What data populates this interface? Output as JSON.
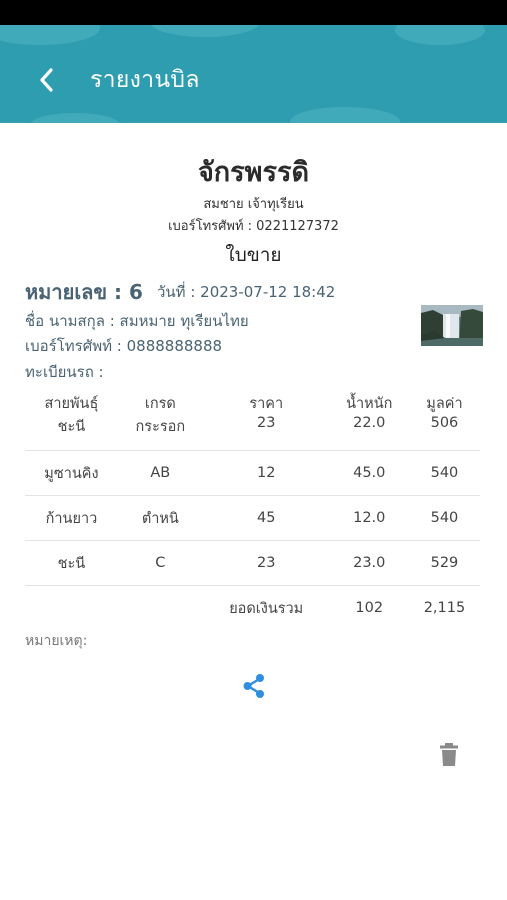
{
  "header": {
    "title": "รายงานบิล",
    "back_icon": "chevron-left-icon",
    "color": "#2f9db0"
  },
  "shop": {
    "name": "จักรพรรดิ",
    "owner": "สมชาย เจ้าทุเรียน",
    "phone": "เบอร์โทรศัพท์ : 0221127372"
  },
  "document_type": "ใบขาย",
  "bill": {
    "number": "หมายเลข : 6",
    "date": "วันที่ : 2023-07-12 18:42",
    "customer": "ชื่อ นามสกุล : สมหมาย ทุเรียนไทย",
    "phone": "เบอร์โทรศัพท์ : 0888888888",
    "plate": "ทะเบียนรถ :"
  },
  "table": {
    "headers": [
      "สายพันธุ์",
      "เกรด",
      "ราคา",
      "น้ำหนัก",
      "มูลค่า"
    ],
    "rows": [
      [
        "ชะนี",
        "กระรอก",
        "23",
        "22.0",
        "506"
      ],
      [
        "มูซานคิง",
        "AB",
        "12",
        "45.0",
        "540"
      ],
      [
        "ก้านยาว",
        "ตำหนิ",
        "45",
        "12.0",
        "540"
      ],
      [
        "ชะนี",
        "C",
        "23",
        "23.0",
        "529"
      ]
    ],
    "total": {
      "label": "ยอดเงินรวม",
      "weight": "102",
      "amount": "2,115"
    }
  },
  "note": "หมายเหตุ:",
  "actions": {
    "share_icon": "share-icon",
    "share_color": "#2e8fe0",
    "delete_icon": "trash-icon",
    "delete_color": "#8a8a8a"
  }
}
